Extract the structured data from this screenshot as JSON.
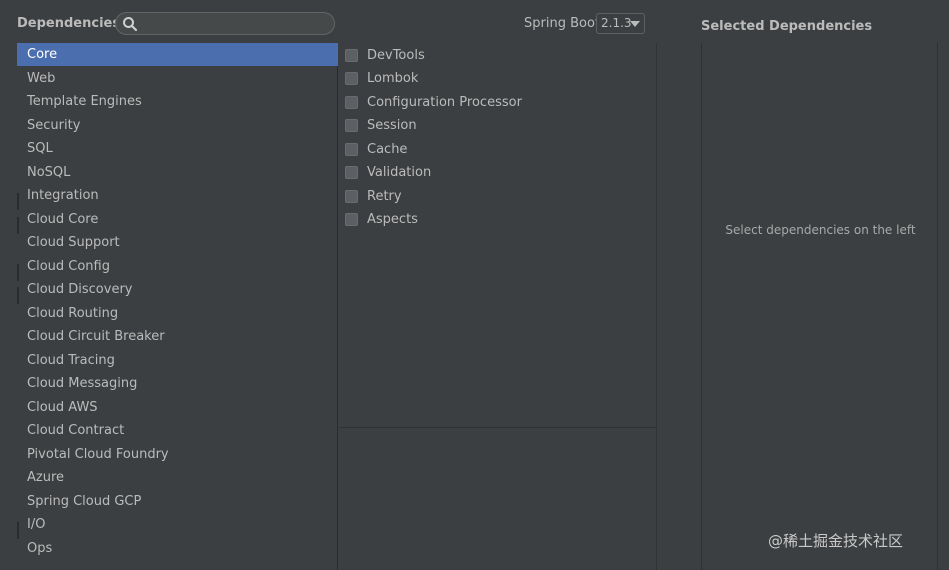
{
  "header": {
    "dependencies_label": "Dependencies",
    "search": {
      "value": "",
      "placeholder": ""
    },
    "spring_boot_label": "Spring Boot",
    "spring_boot_version": "2.1.3"
  },
  "categories": [
    "Core",
    "Web",
    "Template Engines",
    "Security",
    "SQL",
    "NoSQL",
    "Integration",
    "Cloud Core",
    "Cloud Support",
    "Cloud Config",
    "Cloud Discovery",
    "Cloud Routing",
    "Cloud Circuit Breaker",
    "Cloud Tracing",
    "Cloud Messaging",
    "Cloud AWS",
    "Cloud Contract",
    "Pivotal Cloud Foundry",
    "Azure",
    "Spring Cloud GCP",
    "I/O",
    "Ops"
  ],
  "selected_category": "Core",
  "dependencies": [
    "DevTools",
    "Lombok",
    "Configuration Processor",
    "Session",
    "Cache",
    "Validation",
    "Retry",
    "Aspects"
  ],
  "selected_panel": {
    "title": "Selected Dependencies",
    "hint": "Select dependencies on the left"
  },
  "watermark": "@稀土掘金技术社区",
  "icons": {
    "search": "search-icon",
    "dropdown": "chevron-down-icon"
  },
  "colors": {
    "background": "#3c3f41",
    "selection": "#4b6eaf"
  }
}
